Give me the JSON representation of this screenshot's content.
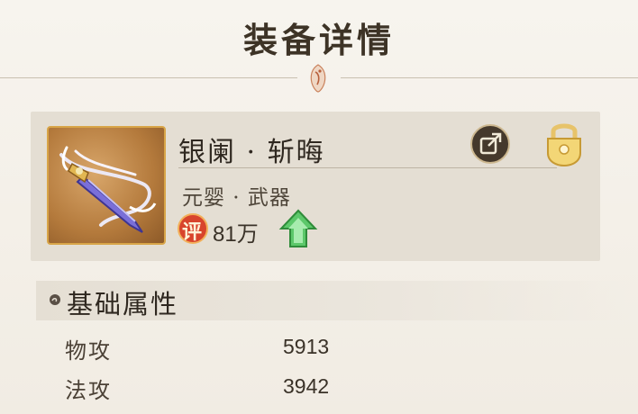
{
  "header": {
    "title": "装备详情"
  },
  "item": {
    "name": "银阑 · 斩晦",
    "type": "元婴 · 武器",
    "score_badge": "评",
    "score_value": "81万",
    "share_icon": "share-icon",
    "lock_icon": "lock-icon"
  },
  "section": {
    "title": "基础属性"
  },
  "stats": [
    {
      "label": "物攻",
      "value": "5913"
    },
    {
      "label": "法攻",
      "value": "3942"
    }
  ],
  "colors": {
    "background": "#f3efe7",
    "card": "#e4ded3",
    "frame_gold": "#d8a548",
    "badge_red": "#d8442c",
    "up_green": "#5cc86a"
  }
}
